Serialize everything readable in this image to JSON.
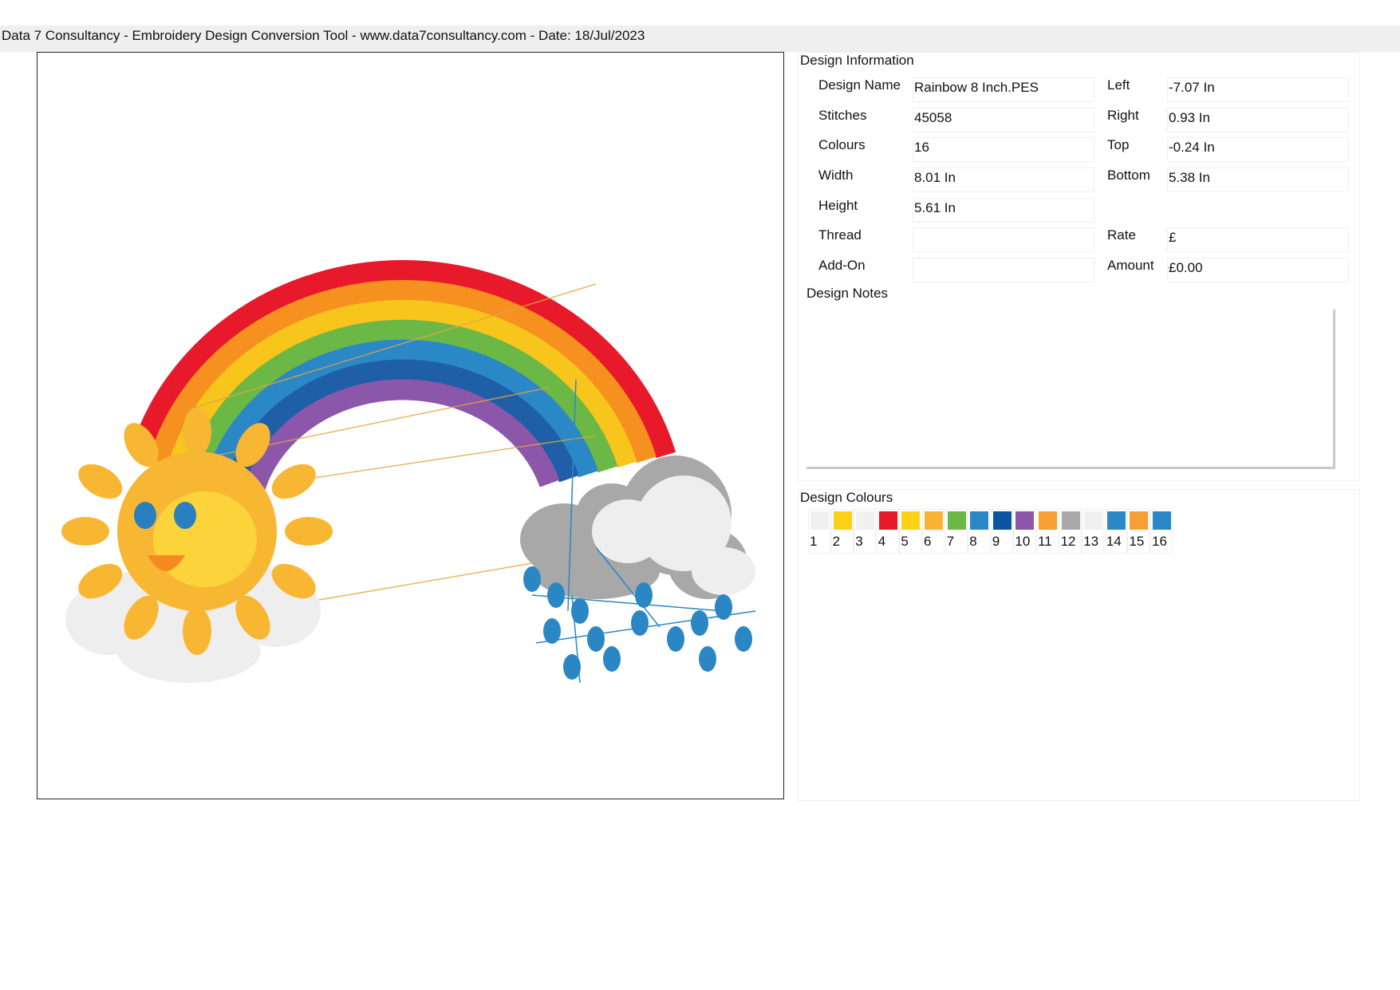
{
  "header": {
    "text": "Data 7 Consultancy - Embroidery Design Conversion Tool - www.data7consultancy.com - Date: 18/Jul/2023"
  },
  "preview": {
    "rainbow_band_colors": [
      "#e8192a",
      "#f6901f",
      "#f7c51b",
      "#6bb846",
      "#2a88c6",
      "#1e5fa8",
      "#8c57aa"
    ],
    "sun_color": "#f7b733",
    "sun_inner_color": "#fcd33a",
    "sun_eye_color": "#2a7fc0",
    "sun_mouth_color": "#f68a1f",
    "cloud_color": "#eeeeee",
    "storm_cloud_color": "#a8a8a8",
    "raindrop_color": "#2b87c4",
    "jump_line_color": "#e9a23b"
  },
  "info": {
    "title": "Design Information",
    "fields": {
      "design_name": {
        "label": "Design Name",
        "value": "Rainbow 8 Inch.PES"
      },
      "stitches": {
        "label": "Stitches",
        "value": "45058"
      },
      "colours": {
        "label": "Colours",
        "value": "16"
      },
      "width": {
        "label": "Width",
        "value": "8.01 In"
      },
      "height": {
        "label": "Height",
        "value": "5.61 In"
      },
      "thread": {
        "label": "Thread",
        "value": ""
      },
      "add_on": {
        "label": "Add-On",
        "value": ""
      },
      "left": {
        "label": "Left",
        "value": "-7.07 In"
      },
      "right": {
        "label": "Right",
        "value": "0.93 In"
      },
      "top": {
        "label": "Top",
        "value": "-0.24 In"
      },
      "bottom": {
        "label": "Bottom",
        "value": "5.38 In"
      },
      "rate": {
        "label": "Rate",
        "value": "£"
      },
      "amount": {
        "label": "Amount",
        "value": "£0.00"
      }
    },
    "notes_label": "Design Notes",
    "notes_value": ""
  },
  "colours_panel": {
    "title": "Design Colours",
    "swatches": [
      {
        "num": "1",
        "color": "#f0f0f0"
      },
      {
        "num": "2",
        "color": "#fcd116"
      },
      {
        "num": "3",
        "color": "#f0f0f0"
      },
      {
        "num": "4",
        "color": "#e8192a"
      },
      {
        "num": "5",
        "color": "#fcd116"
      },
      {
        "num": "6",
        "color": "#f9b233"
      },
      {
        "num": "7",
        "color": "#6bb846"
      },
      {
        "num": "8",
        "color": "#2a88c6"
      },
      {
        "num": "9",
        "color": "#0b55a0"
      },
      {
        "num": "10",
        "color": "#8c57aa"
      },
      {
        "num": "11",
        "color": "#f6a033"
      },
      {
        "num": "12",
        "color": "#a9a9a9"
      },
      {
        "num": "13",
        "color": "#f0f0f0"
      },
      {
        "num": "14",
        "color": "#2a88c6"
      },
      {
        "num": "15",
        "color": "#f6a033"
      },
      {
        "num": "16",
        "color": "#2a88c6"
      }
    ]
  }
}
